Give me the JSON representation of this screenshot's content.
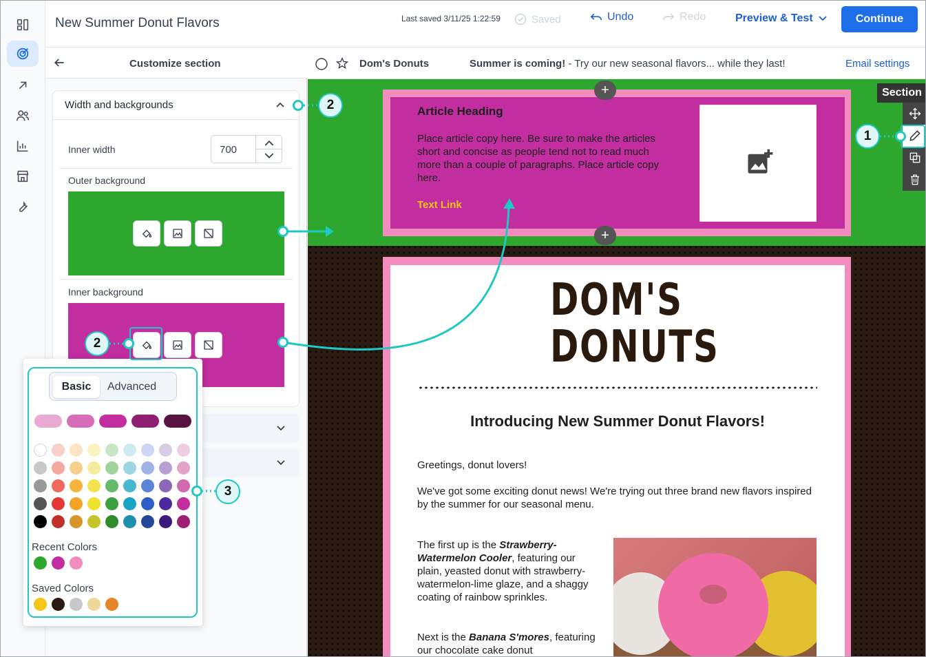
{
  "header": {
    "title": "New Summer Donut Flavors",
    "last_saved": "Last saved 3/11/25 1:22:59",
    "saved_label": "Saved",
    "undo_label": "Undo",
    "redo_label": "Redo",
    "preview_label": "Preview & Test",
    "continue_label": "Continue"
  },
  "panel": {
    "title": "Customize section",
    "section_label": "Width and backgrounds",
    "inner_width_label": "Inner width",
    "inner_width_value": "700",
    "outer_bg_label": "Outer background",
    "inner_bg_label": "Inner background"
  },
  "colors": {
    "outer_bg": "#2ea72e",
    "inner_bg": "#c22d9f",
    "accent": "#1d6ee8",
    "callout": "#1fc8c2"
  },
  "email_bar": {
    "from_name": "Dom's Donuts",
    "subject_bold": "Summer is coming!",
    "subject_rest": " - Try our new seasonal flavors... while they last!",
    "settings_label": "Email settings"
  },
  "article": {
    "heading": "Article Heading",
    "body": "Place article copy here. Be sure to make the articles short and concise as people tend not to read much more than a couple of paragraphs. Place article copy here.",
    "link": "Text Link"
  },
  "section_toolbar": {
    "label": "Section"
  },
  "email": {
    "logo_line1": "DOM'S",
    "logo_line2": "DONUTS",
    "headline": "Introducing New Summer Donut Flavors!",
    "greeting": "Greetings, donut lovers!",
    "para1": "We've got some exciting donut news! We're trying out three brand new flavors inspired by the summer for our seasonal menu.",
    "para2_pre": "The first up is the ",
    "para2_em": "Strawberry-Watermelon Cooler",
    "para2_post": ", featuring our plain, yeasted donut with strawberry-watermelon-lime glaze, and a shaggy coating of rainbow sprinkles.",
    "para3_pre": "Next is the ",
    "para3_em": "Banana S'mores",
    "para3_post": ", featuring our chocolate cake donut"
  },
  "picker": {
    "tab_basic": "Basic",
    "tab_advanced": "Advanced",
    "top_row": [
      "#e8a9d3",
      "#d76cb8",
      "#c22d9f",
      "#8e1f72",
      "#571441"
    ],
    "grid": [
      [
        "#ffffff",
        "#f8cfc9",
        "#fce4c4",
        "#fbf3c2",
        "#c9e6c6",
        "#cfe9f0",
        "#cdd6f2",
        "#d9cbe4",
        "#efcde3"
      ],
      [
        "#c8c8c8",
        "#f4a89f",
        "#f9cf8c",
        "#f7ec9b",
        "#9fd39b",
        "#9dd5e3",
        "#9eb2e6",
        "#b7a1d2",
        "#e3a4cb"
      ],
      [
        "#999999",
        "#ef6a5c",
        "#f6b43c",
        "#f3e44f",
        "#66bb6a",
        "#48b7d2",
        "#5b84d9",
        "#8a67b8",
        "#d16aac"
      ],
      [
        "#555555",
        "#e53935",
        "#f4a425",
        "#ede22c",
        "#3aa13e",
        "#1aa3c2",
        "#2f5ec9",
        "#4a2a9e",
        "#c22d9f"
      ],
      [
        "#000000",
        "#c2302a",
        "#d8962a",
        "#c6c42a",
        "#2e8b2e",
        "#1f8fae",
        "#24479c",
        "#3a1a7e",
        "#9e1f75"
      ]
    ],
    "recent_label": "Recent Colors",
    "recent": [
      "#2ea72e",
      "#c22d9f",
      "#f28cbf"
    ],
    "saved_label": "Saved Colors",
    "saved": [
      "#f5c518",
      "#2a1a12",
      "#c8c8c8",
      "#ecd898",
      "#e6862a"
    ]
  },
  "callouts": [
    "1",
    "2",
    "2",
    "3"
  ]
}
